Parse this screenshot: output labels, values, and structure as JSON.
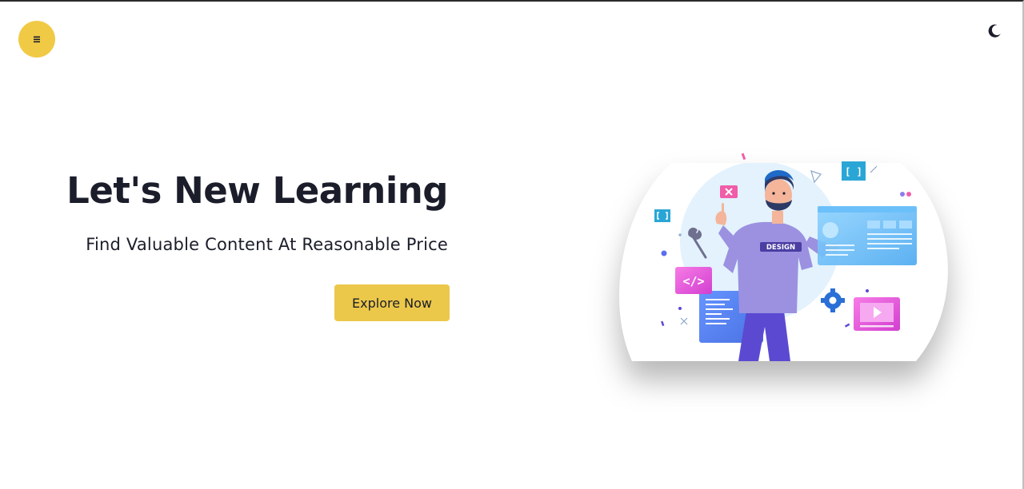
{
  "header": {
    "menu_icon": "menu-icon",
    "theme_icon": "moon-icon"
  },
  "hero": {
    "title": "Let's New Learning",
    "subtitle": "Find Valuable Content At Reasonable Price",
    "cta_label": "Explore Now",
    "illustration": {
      "shirt_text": "DESIGN",
      "code_symbol": "</>",
      "bracket_symbol": "[ ]"
    }
  },
  "colors": {
    "accent": "#f0ca45",
    "text": "#1b1d2a"
  }
}
